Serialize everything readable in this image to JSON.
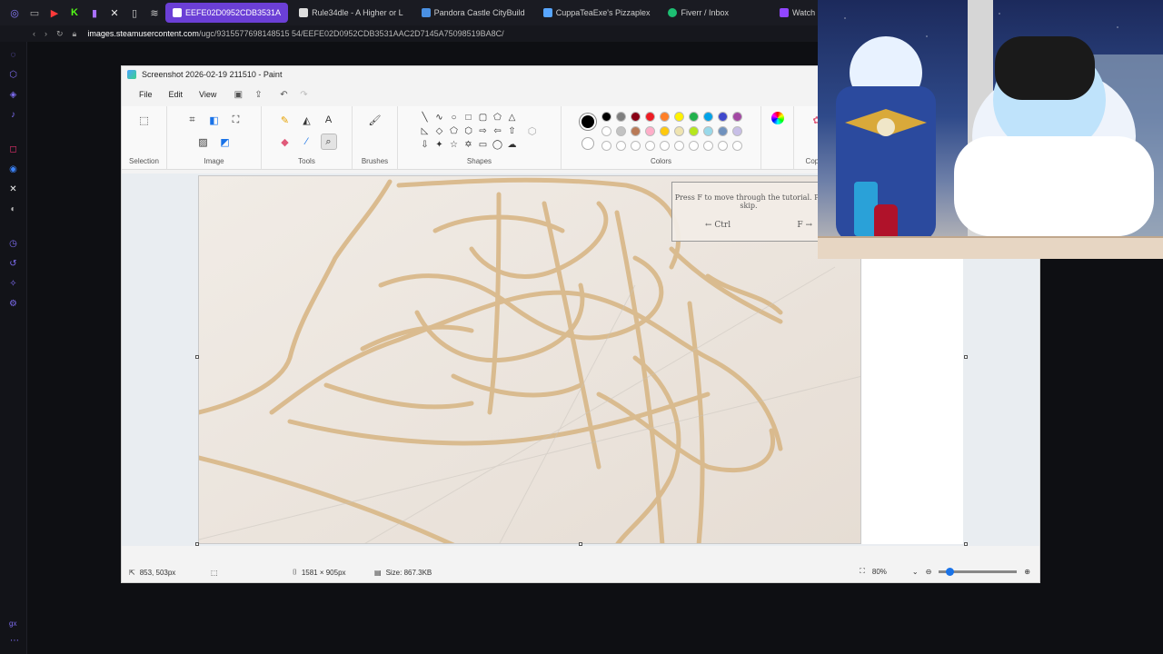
{
  "browser": {
    "tabs": [
      {
        "label": "EEFE02D0952CDB3531A",
        "active": true,
        "color": "#6b3fd6"
      },
      {
        "label": "Rule34dle - A Higher or L",
        "active": false,
        "color": "#dddddd"
      },
      {
        "label": "Pandora Castle CityBuild",
        "active": false,
        "color": "#4a90e2"
      },
      {
        "label": "CuppaTeaExe's Pizzaplex",
        "active": false,
        "color": "#58a6ff"
      },
      {
        "label": "Fiverr / Inbox",
        "active": false,
        "color": "#1dbf73"
      },
      {
        "label": "Watch Martial",
        "active": false,
        "color": "#9146ff"
      }
    ],
    "url_host": "images.steamusercontent.com",
    "url_path": "/ugc/9315577698148515 54/EEFE02D0952CDB3531AAC2D7145A75098519BA8C/"
  },
  "paint": {
    "title": "Screenshot 2026-02-19 211510 - Paint",
    "menu": [
      "File",
      "Edit",
      "View"
    ],
    "groups": {
      "selection": "Selection",
      "image": "Image",
      "tools": "Tools",
      "brushes": "Brushes",
      "shapes": "Shapes",
      "colors": "Colors",
      "copilot": "Copilot"
    },
    "palette": [
      "#000000",
      "#7f7f7f",
      "#880015",
      "#ed1c24",
      "#ff7f27",
      "#fff200",
      "#22b14c",
      "#00a2e8",
      "#3f48cc",
      "#a349a4",
      "#ffffff",
      "#c3c3c3",
      "#b97a57",
      "#ffaec9",
      "#ffc90e",
      "#efe4b0",
      "#b5e61d",
      "#99d9ea",
      "#7092be",
      "#c8bfe7",
      "#ffffff",
      "#ffffff",
      "#ffffff",
      "#ffffff",
      "#ffffff",
      "#ffffff",
      "#ffffff",
      "#ffffff",
      "#ffffff",
      "#ffffff"
    ],
    "tutorial": {
      "text": "Press F to move through the tutorial. Pr skip.",
      "left_key": "← Ctrl",
      "right_key": "F →"
    },
    "status": {
      "cursor": "853, 503px",
      "canvas_size": "1581 × 905px",
      "file_size": "Size: 867.3KB",
      "zoom": "80%"
    }
  }
}
